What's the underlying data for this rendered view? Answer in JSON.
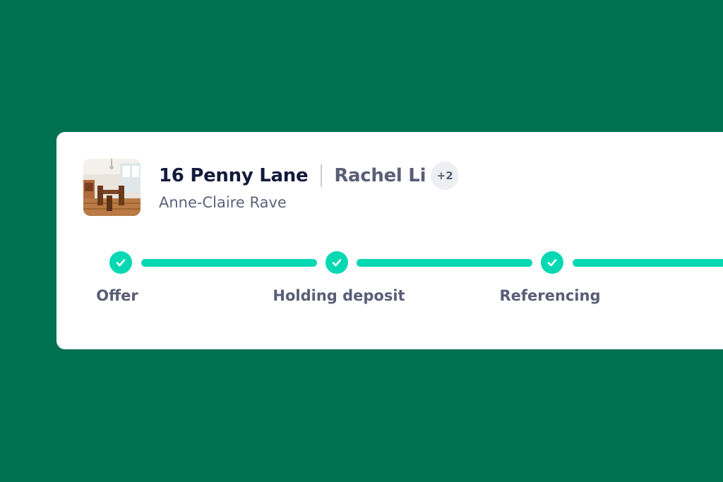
{
  "property": {
    "address": "16 Penny Lane",
    "tenant": "Rachel Li",
    "extra_tenants": "+2",
    "agent": "Anne-Claire Rave",
    "thumbnail": "dining-room-photo"
  },
  "steps": [
    {
      "label": "Offer",
      "status": "complete",
      "icon": "check-icon"
    },
    {
      "label": "Holding deposit",
      "status": "complete",
      "icon": "check-icon"
    },
    {
      "label": "Referencing",
      "status": "complete",
      "icon": "check-icon"
    }
  ],
  "colors": {
    "background": "#007151",
    "card": "#ffffff",
    "accent": "#05d8b3",
    "title": "#141a3b",
    "muted": "#5a5d76"
  }
}
